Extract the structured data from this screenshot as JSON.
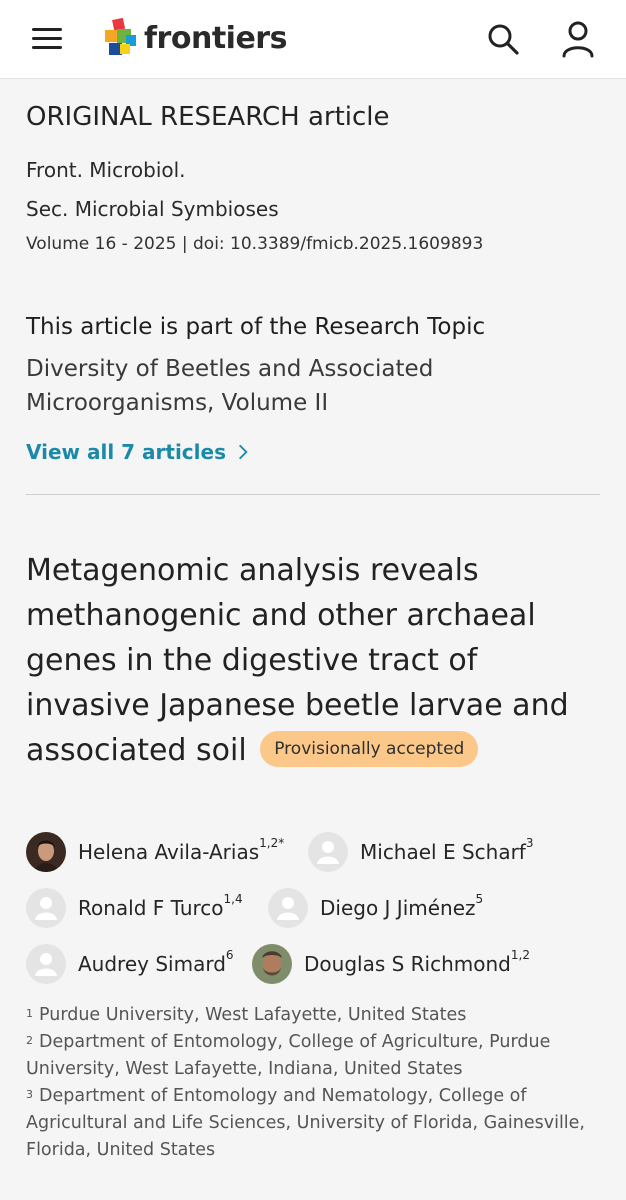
{
  "header": {
    "brand": "frontiers",
    "icons": [
      "menu-icon",
      "search-icon",
      "user-icon"
    ]
  },
  "article": {
    "type": "ORIGINAL RESEARCH article",
    "journal": "Front. Microbiol.",
    "section": "Sec. Microbial Symbioses",
    "volume_doi": "Volume 16 - 2025 | doi: 10.3389/fmicb.2025.1609893"
  },
  "research_topic": {
    "heading": "This article is part of the Research Topic",
    "name": "Diversity of Beetles and Associated Microorganisms, Volume II",
    "view_all": "View all 7 articles",
    "chevron": "›"
  },
  "title": {
    "text": "Metagenomic analysis reveals methanogenic and other archaeal genes in the digestive tract of invasive Japanese beetle larvae and associated soil",
    "badge": "Provisionally accepted"
  },
  "authors": [
    {
      "name": "Helena Avila-Arias",
      "sup": "1,2*",
      "photo": true
    },
    {
      "name": "Michael E Scharf",
      "sup": "3",
      "photo": false
    },
    {
      "name": "Ronald F Turco",
      "sup": "1,4",
      "photo": false
    },
    {
      "name": "Diego J Jiménez",
      "sup": "5",
      "photo": false
    },
    {
      "name": "Audrey Simard",
      "sup": "6",
      "photo": false
    },
    {
      "name": "Douglas S Richmond",
      "sup": "1,2",
      "photo": true
    }
  ],
  "affiliations": [
    {
      "num": "1",
      "text": "Purdue University, West Lafayette, United States"
    },
    {
      "num": "2",
      "text": "Department of Entomology, College of Agriculture, Purdue University, West Lafayette, Indiana, United States"
    },
    {
      "num": "3",
      "text": "Department of Entomology and Nematology, College of Agricultural and Life Sciences, University of Florida, Gainesville, Florida, United States"
    }
  ],
  "colors": {
    "accent_link": "#1b8aa8",
    "badge_bg": "#fcc88a",
    "background": "#f5f5f5"
  }
}
